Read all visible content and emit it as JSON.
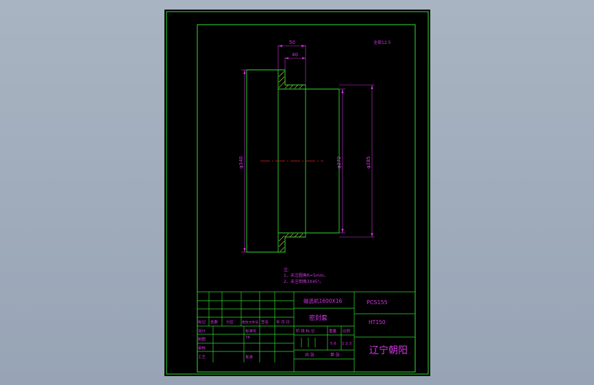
{
  "colors": {
    "border": "#2fe32f",
    "part": "#2fe32f",
    "dimension": "#d535e6",
    "centerline": "#e8221e",
    "hatch": "#e3c62d",
    "background": "#000000"
  },
  "drawing": {
    "roughness_note": "全部12.5",
    "dimensions": {
      "width_outer": "50",
      "width_inner": "40",
      "dia_outer": "φ340",
      "dia_bore": "φ272",
      "dia_step": "φ285"
    },
    "notes": {
      "heading": "注:",
      "line1": "1、未注圆角R=5mm。",
      "line2": "2、未注倒角3X45°。"
    }
  },
  "title_block": {
    "machine": "磁选机1600X16",
    "part_name": "密封套",
    "drawing_no": "PCS155",
    "material": "HT150",
    "company": "辽宁朝阳",
    "labels": {
      "mark": "标记",
      "count": "处数",
      "zone": "分区",
      "change_doc": "更改文件号",
      "signature": "签名",
      "date": "年 月 日",
      "design": "设计",
      "drafting": "制图",
      "review": "审核",
      "process": "工艺",
      "standardize": "标准化",
      "approve": "批准",
      "stage_mark": "阶 段 标 记",
      "weight": "重量",
      "scale": "比例",
      "sheets_total": "共 张",
      "sheet_no": "第 张"
    },
    "values": {
      "weight": "5.6",
      "scale": "1:2.3",
      "standardize_note": "76"
    }
  }
}
